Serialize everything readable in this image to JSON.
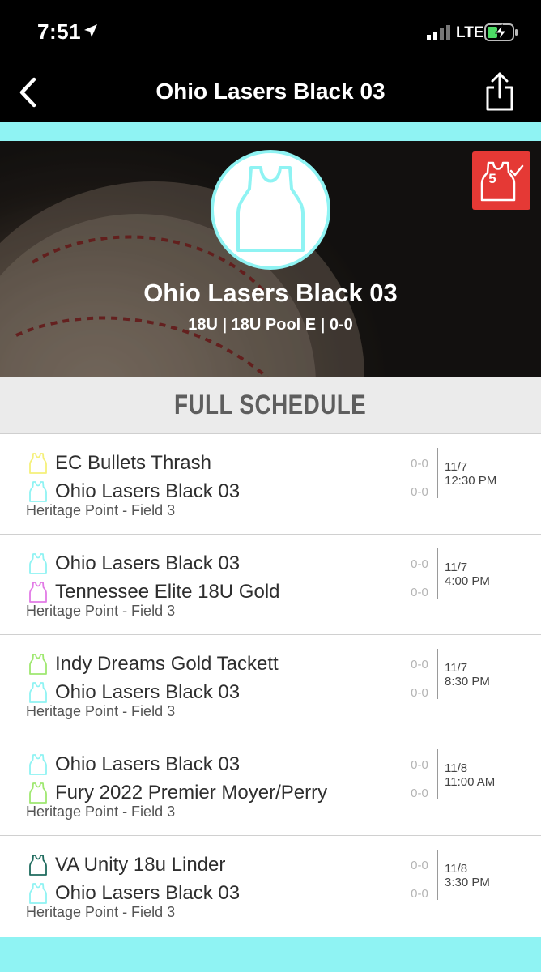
{
  "status_bar": {
    "time": "7:51",
    "carrier": "LTE",
    "icons": [
      "location-arrow-icon",
      "signal-icon",
      "battery-charging-icon"
    ]
  },
  "nav": {
    "title": "Ohio Lasers Black 03",
    "icons": [
      "chevron-left-icon",
      "share-icon"
    ]
  },
  "hero": {
    "team_name": "Ohio Lasers Black 03",
    "subtitle": "18U | 18U Pool E | 0-0",
    "badge_count": "5",
    "icons": [
      "jersey-icon",
      "jersey-check-icon"
    ]
  },
  "schedule": {
    "title": "FULL SCHEDULE",
    "games": [
      {
        "team1": "EC Bullets Thrash",
        "team1_color": "#f5f07a",
        "score1": "0-0",
        "team2": "Ohio Lasers Black 03",
        "team2_color": "#8ff3f3",
        "score2": "0-0",
        "venue": "Heritage Point - Field 3",
        "date": "11/7",
        "time": "12:30 PM"
      },
      {
        "team1": "Ohio Lasers Black 03",
        "team1_color": "#8ff3f3",
        "score1": "0-0",
        "team2": "Tennessee Elite 18U Gold",
        "team2_color": "#e27ae6",
        "score2": "0-0",
        "venue": "Heritage Point - Field 3",
        "date": "11/7",
        "time": "4:00 PM"
      },
      {
        "team1": "Indy Dreams Gold Tackett",
        "team1_color": "#9fe870",
        "score1": "0-0",
        "team2": "Ohio Lasers Black 03",
        "team2_color": "#8ff3f3",
        "score2": "0-0",
        "venue": "Heritage Point - Field 3",
        "date": "11/7",
        "time": "8:30 PM"
      },
      {
        "team1": "Ohio Lasers Black 03",
        "team1_color": "#8ff3f3",
        "score1": "0-0",
        "team2": "Fury 2022 Premier Moyer/Perry",
        "team2_color": "#9fe870",
        "score2": "0-0",
        "venue": "Heritage Point - Field 3",
        "date": "11/8",
        "time": "11:00 AM"
      },
      {
        "team1": "VA Unity 18u Linder",
        "team1_color": "#1f6b5e",
        "score1": "0-0",
        "team2": "Ohio Lasers Black 03",
        "team2_color": "#8ff3f3",
        "score2": "0-0",
        "venue": "Heritage Point - Field 3",
        "date": "11/8",
        "time": "3:30 PM"
      }
    ]
  },
  "colors": {
    "accent": "#8ff3f3",
    "badge": "#e53935",
    "header_bg": "#000000"
  }
}
